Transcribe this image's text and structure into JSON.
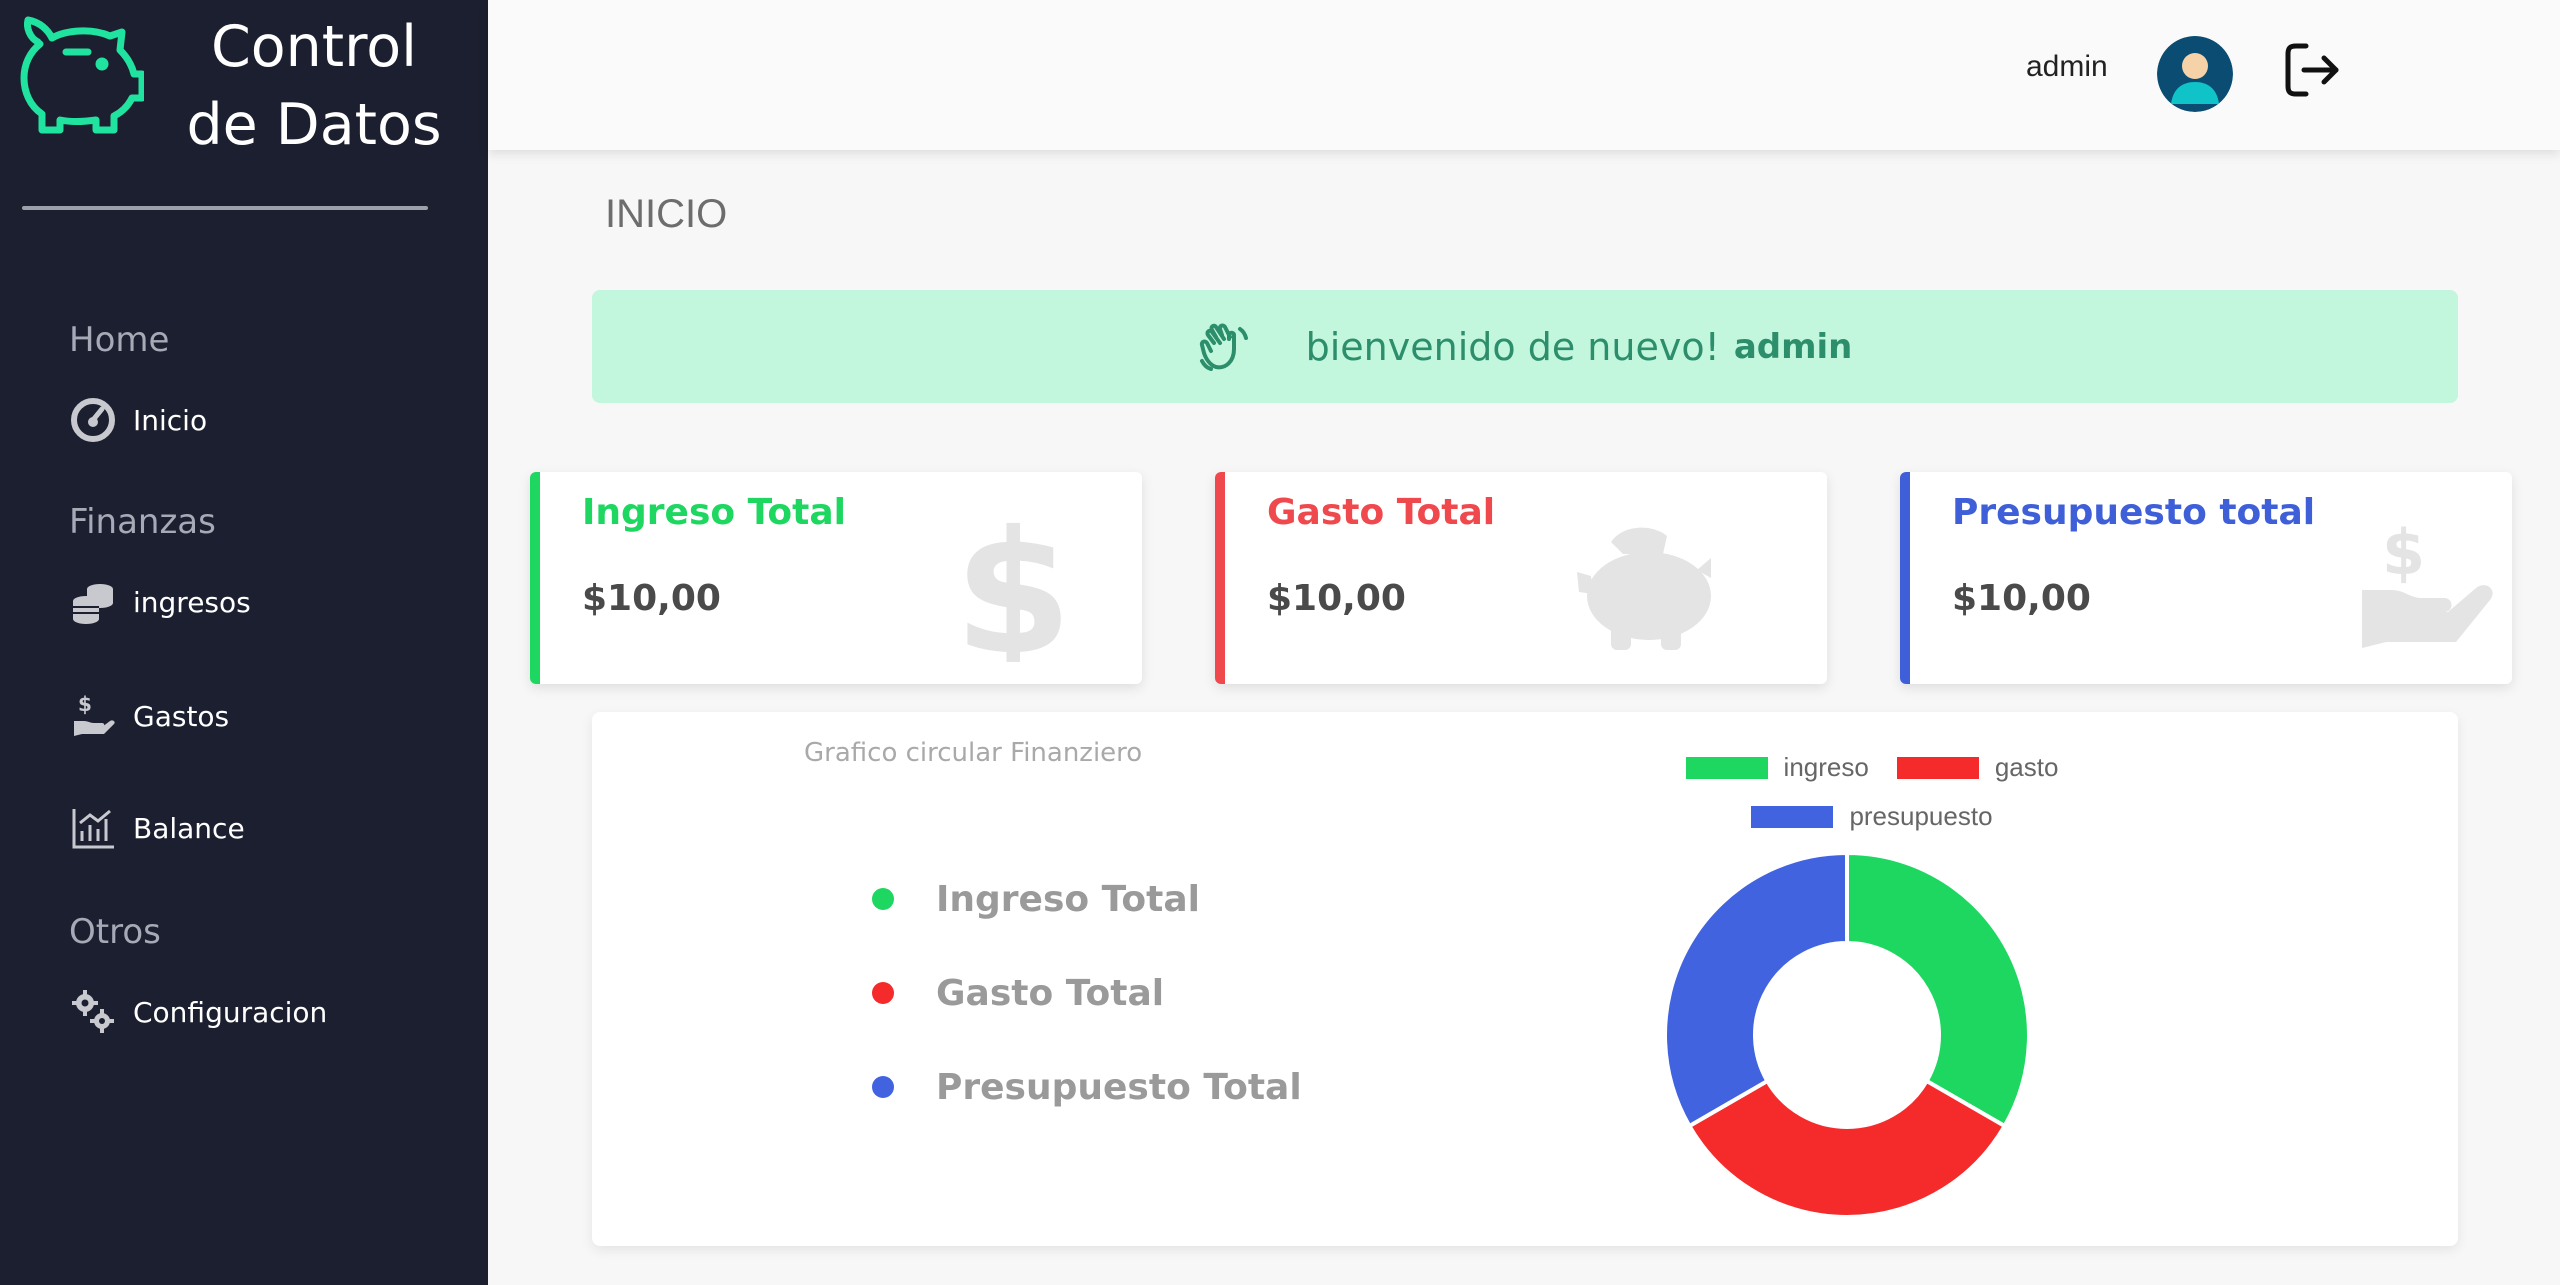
{
  "brand": {
    "title": "Control de Datos",
    "accent": "#20e3a0"
  },
  "sidebar": {
    "sections": [
      {
        "label": "Home",
        "items": [
          {
            "label": "Inicio",
            "icon": "dashboard-gauge-icon"
          }
        ]
      },
      {
        "label": "Finanzas",
        "items": [
          {
            "label": "ingresos",
            "icon": "coins-stack-icon"
          },
          {
            "label": "Gastos",
            "icon": "hand-dollar-icon"
          },
          {
            "label": "Balance",
            "icon": "bar-chart-icon"
          }
        ]
      },
      {
        "label": "Otros",
        "items": [
          {
            "label": "Configuracion",
            "icon": "gears-icon"
          }
        ]
      }
    ]
  },
  "topbar": {
    "username": "admin",
    "avatar_icon": "user-avatar-icon",
    "logout_icon": "logout-icon"
  },
  "page": {
    "title": "INICIO"
  },
  "welcome": {
    "text": "bienvenido de nuevo!",
    "user": "admin",
    "icon": "waving-hand-icon"
  },
  "cards": [
    {
      "title": "Ingreso Total",
      "value": "$10,00",
      "color": "#1ed760",
      "icon": "dollar-icon"
    },
    {
      "title": "Gasto Total",
      "value": "$10,00",
      "color": "#f0494d",
      "icon": "piggy-bank-icon"
    },
    {
      "title": "Presupuesto total",
      "value": "$10,00",
      "color": "#3f5fd9",
      "icon": "hand-dollar-icon"
    }
  ],
  "chart": {
    "title": "Grafico circular Finanziero",
    "legend_list": [
      {
        "label": "Ingreso Total",
        "color": "#1ed760"
      },
      {
        "label": "Gasto Total",
        "color": "#f52a2a"
      },
      {
        "label": "Presupuesto Total",
        "color": "#4163e0"
      }
    ]
  },
  "chart_data": {
    "type": "pie",
    "variant": "doughnut",
    "categories": [
      "ingreso",
      "gasto",
      "presupuesto"
    ],
    "values": [
      10,
      10,
      10
    ],
    "colors": [
      "#1ed760",
      "#f52a2a",
      "#4163e0"
    ],
    "legend_position": "top"
  }
}
